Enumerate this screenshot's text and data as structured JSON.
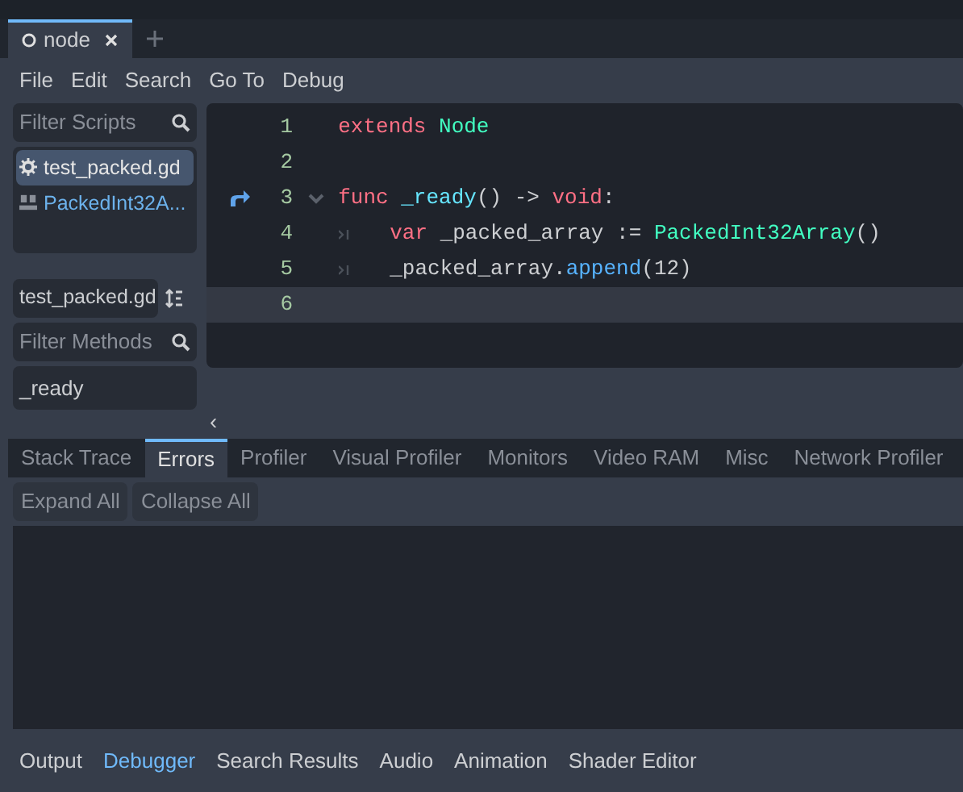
{
  "scene_tabs": [
    {
      "label": "node",
      "selected": true
    }
  ],
  "menu": [
    "File",
    "Edit",
    "Search",
    "Go To",
    "Debug"
  ],
  "scripts_filter": {
    "placeholder": "Filter Scripts"
  },
  "scripts": [
    {
      "label": "test_packed.gd",
      "kind": "script",
      "selected": true
    },
    {
      "label": "PackedInt32A...",
      "kind": "doc",
      "selected": false
    }
  ],
  "current_script": "test_packed.gd",
  "methods_filter": {
    "placeholder": "Filter Methods"
  },
  "methods": [
    "_ready"
  ],
  "code": [
    {
      "number": "1",
      "indented": false,
      "override": false,
      "foldable": false,
      "selected": false,
      "tokens": [
        {
          "text": "extends",
          "kind": "keyword"
        },
        {
          "text": " Node",
          "kind": "type"
        }
      ]
    },
    {
      "number": "2",
      "indented": false,
      "override": false,
      "foldable": false,
      "selected": false
    },
    {
      "number": "3",
      "indented": false,
      "override": true,
      "foldable": true,
      "selected": false,
      "tokens": [
        {
          "text": "func",
          "kind": "keyword"
        },
        {
          "text": " _ready",
          "kind": "function"
        },
        {
          "text": "() -> ",
          "kind": "text"
        },
        {
          "text": "void",
          "kind": "keyword"
        },
        {
          "text": ":",
          "kind": "text"
        }
      ]
    },
    {
      "number": "4",
      "indented": true,
      "override": false,
      "foldable": false,
      "selected": false,
      "tokens": [
        {
          "text": "var",
          "kind": "keyword"
        },
        {
          "text": " _packed_array := ",
          "kind": "text"
        },
        {
          "text": "PackedInt32Array",
          "kind": "type"
        },
        {
          "text": "()",
          "kind": "text"
        }
      ]
    },
    {
      "number": "5",
      "indented": true,
      "override": false,
      "foldable": false,
      "selected": false,
      "tokens": [
        {
          "text": "_packed_array.",
          "kind": "text"
        },
        {
          "text": "append",
          "kind": "method"
        },
        {
          "text": "(12)",
          "kind": "text"
        }
      ]
    },
    {
      "number": "6",
      "indented": false,
      "override": false,
      "foldable": false,
      "selected": true
    }
  ],
  "toggle": "‹",
  "debugger_tabs": [
    {
      "label": "Stack Trace",
      "selected": false
    },
    {
      "label": "Errors",
      "selected": true
    },
    {
      "label": "Profiler",
      "selected": false
    },
    {
      "label": "Visual Profiler",
      "selected": false
    },
    {
      "label": "Monitors",
      "selected": false
    },
    {
      "label": "Video RAM",
      "selected": false
    },
    {
      "label": "Misc",
      "selected": false
    },
    {
      "label": "Network Profiler",
      "selected": false
    }
  ],
  "error_buttons": [
    "Expand All",
    "Collapse All"
  ],
  "bottom_tabs": [
    {
      "label": "Output",
      "selected": false
    },
    {
      "label": "Debugger",
      "selected": true
    },
    {
      "label": "Search Results",
      "selected": false
    },
    {
      "label": "Audio",
      "selected": false
    },
    {
      "label": "Animation",
      "selected": false
    },
    {
      "label": "Shader Editor",
      "selected": false
    }
  ]
}
